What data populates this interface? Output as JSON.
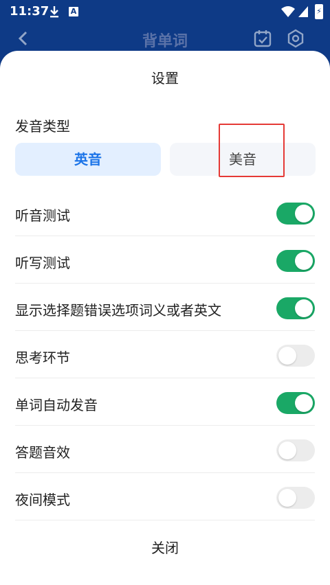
{
  "status": {
    "time": "11:37"
  },
  "app_bar": {
    "title": "背单词"
  },
  "sheet": {
    "title": "设置",
    "pronunciation": {
      "label": "发音类型",
      "options": [
        {
          "label": "英音",
          "selected": true
        },
        {
          "label": "美音",
          "selected": false
        }
      ]
    },
    "settings": [
      {
        "label": "听音测试",
        "on": true
      },
      {
        "label": "听写测试",
        "on": true
      },
      {
        "label": "显示选择题错误选项词义或者英文",
        "on": true
      },
      {
        "label": "思考环节",
        "on": false
      },
      {
        "label": "单词自动发音",
        "on": true
      },
      {
        "label": "答题音效",
        "on": false
      },
      {
        "label": "夜间模式",
        "on": false
      }
    ],
    "close_label": "关闭"
  },
  "colors": {
    "accent": "#1a73e8",
    "toggle_on": "#1aa866",
    "header": "#0e3a86",
    "highlight": "#e53935"
  }
}
